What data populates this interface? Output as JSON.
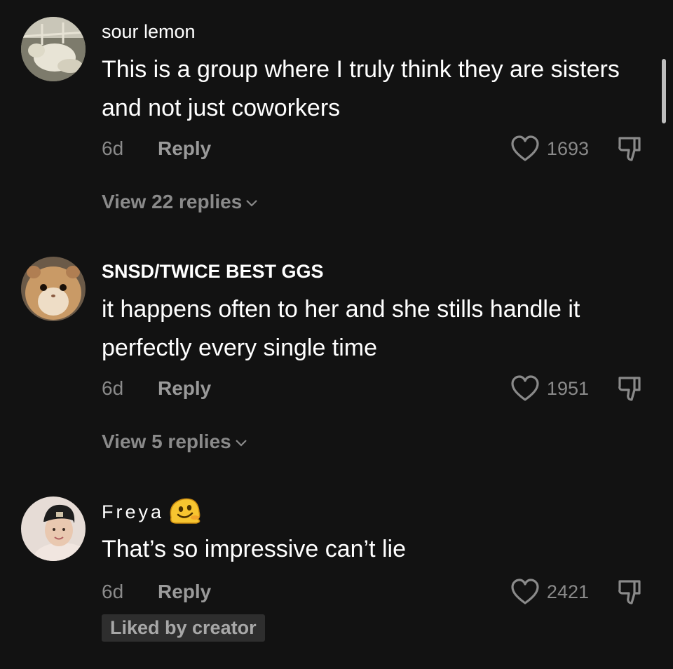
{
  "comments": [
    {
      "username": "sour lemon",
      "text": "This is a group where I truly think they are sisters and not just coworkers",
      "time": "6d",
      "reply_label": "Reply",
      "likes": "1693",
      "view_replies": "View 22 replies",
      "avatar_icon": "sheep-avatar"
    },
    {
      "username": "SNSD/TWICE BEST GGS",
      "text": "it happens often to her and she stills handle it perfectly every single time",
      "time": "6d",
      "reply_label": "Reply",
      "likes": "1951",
      "view_replies": "View 5 replies",
      "avatar_icon": "hamster-avatar"
    },
    {
      "username": "Freya",
      "username_emoji": "melting-face-emoji",
      "text": "That’s so impressive can’t lie",
      "time": "6d",
      "reply_label": "Reply",
      "likes": "2421",
      "badge": "Liked by creator",
      "avatar_icon": "person-beanie-avatar"
    }
  ],
  "colors": {
    "background": "#121212",
    "text_primary": "#ffffff",
    "text_secondary": "#8a8a8a",
    "badge_bg": "#2e2e2e"
  }
}
